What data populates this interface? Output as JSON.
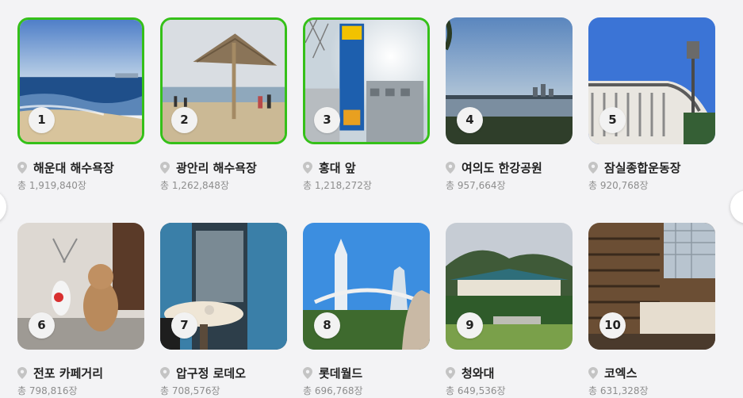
{
  "colors": {
    "selected_border": "#35c019",
    "text_primary": "#222222",
    "text_secondary": "#8d8d8d",
    "pin": "#c4c4c4"
  },
  "places": [
    {
      "rank": "1",
      "name": "해운대 해수욕장",
      "count": "총 1,919,840장",
      "selected": true
    },
    {
      "rank": "2",
      "name": "광안리 해수욕장",
      "count": "총 1,262,848장",
      "selected": true
    },
    {
      "rank": "3",
      "name": "홍대 앞",
      "count": "총 1,218,272장",
      "selected": true
    },
    {
      "rank": "4",
      "name": "여의도 한강공원",
      "count": "총 957,664장",
      "selected": false
    },
    {
      "rank": "5",
      "name": "잠실종합운동장",
      "count": "총 920,768장",
      "selected": false
    },
    {
      "rank": "6",
      "name": "전포 카페거리",
      "count": "총 798,816장",
      "selected": false
    },
    {
      "rank": "7",
      "name": "압구정 로데오",
      "count": "총 708,576장",
      "selected": false
    },
    {
      "rank": "8",
      "name": "롯데월드",
      "count": "총 696,768장",
      "selected": false
    },
    {
      "rank": "9",
      "name": "청와대",
      "count": "총 649,536장",
      "selected": false
    },
    {
      "rank": "10",
      "name": "코엑스",
      "count": "총 631,328장",
      "selected": false
    }
  ],
  "icons": {
    "location": "map-pin-icon",
    "prev": "carousel-prev-button",
    "next": "carousel-next-button"
  }
}
